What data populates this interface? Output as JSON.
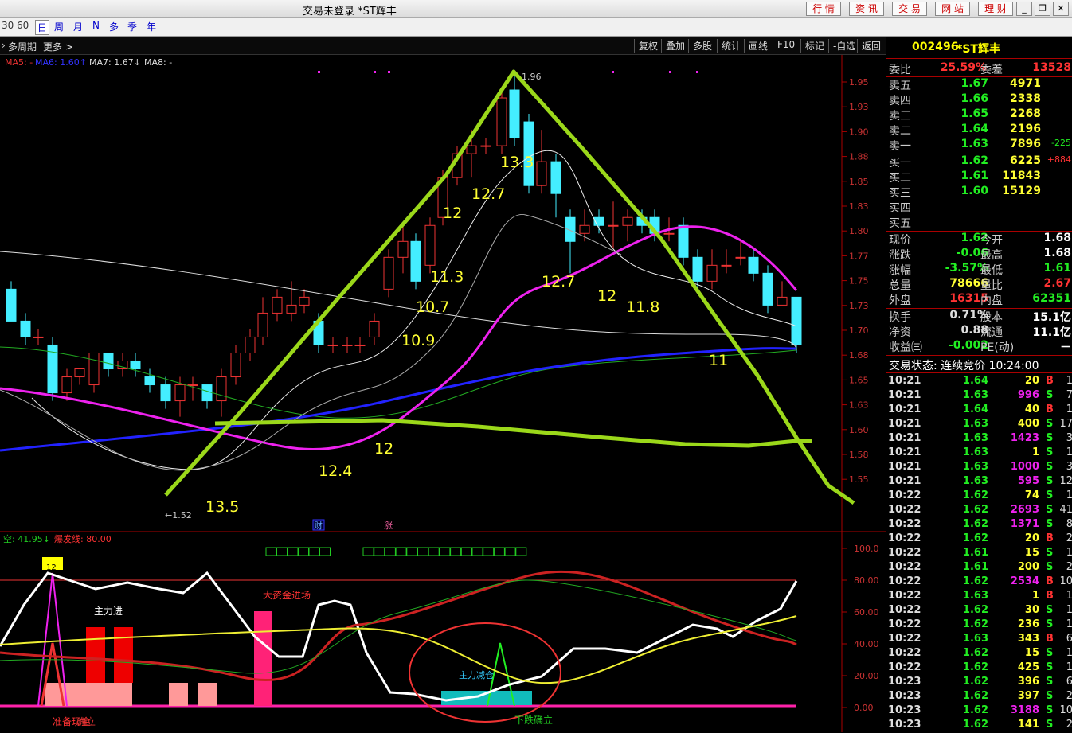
{
  "window": {
    "title": "交易未登录 *ST辉丰",
    "buttons": [
      "行 情",
      "资 讯",
      "交 易",
      "网 站",
      "理 财"
    ]
  },
  "toolbar": {
    "items": [
      "30",
      "60",
      "日",
      "周",
      "月",
      "N",
      "多",
      "季",
      "年"
    ]
  },
  "chartbar": {
    "left": [
      "多周期",
      "更多 >"
    ],
    "right": [
      "复权",
      "叠加",
      "多股",
      "统计",
      "画线",
      "F10",
      "标记",
      "-自选",
      "返回"
    ]
  },
  "ma_legend": {
    "ma5": "MA5: -",
    "ma6": "MA6: 1.60↑",
    "ma7": "MA7: 1.67↓",
    "ma8": "MA8: -"
  },
  "price_axis": [
    "1.95",
    "1.93",
    "1.90",
    "1.88",
    "1.85",
    "1.83",
    "1.80",
    "1.77",
    "1.75",
    "1.73",
    "1.70",
    "1.68",
    "1.65",
    "1.63",
    "1.60",
    "1.58",
    "1.55"
  ],
  "markers": {
    "high": "1.96",
    "low": "←1.52",
    "cai": "财",
    "zhang": "涨"
  },
  "annotations": [
    "13.3",
    "12.7",
    "12",
    "11.3",
    "10.7",
    "10.9",
    "12.7",
    "12",
    "11.8",
    "11",
    "12.4",
    "12",
    "13.5"
  ],
  "indicator": {
    "legend_kong": "空: 41.95↓",
    "legend_line": "爆发线: 80.00",
    "axis": [
      "100.0",
      "80.00",
      "60.00",
      "40.00",
      "20.00",
      "0.00"
    ],
    "labels": {
      "zhulijin": "主力进",
      "dazijin": "大资金进场",
      "zhulijianc": "主力减仓",
      "zhunbei": "准备现金",
      "xiadie": "下跌确立",
      "quelabel": "确立",
      "num": "12"
    }
  },
  "quote": {
    "code": "002496",
    "name": "*ST辉丰",
    "weibi": {
      "label": "委比",
      "value": "25.59%",
      "label2": "委差",
      "value2": "13528"
    },
    "sells": [
      {
        "label": "卖五",
        "price": "1.67",
        "vol": "4971",
        "chg": ""
      },
      {
        "label": "卖四",
        "price": "1.66",
        "vol": "2338",
        "chg": ""
      },
      {
        "label": "卖三",
        "price": "1.65",
        "vol": "2268",
        "chg": ""
      },
      {
        "label": "卖二",
        "price": "1.64",
        "vol": "2196",
        "chg": ""
      },
      {
        "label": "卖一",
        "price": "1.63",
        "vol": "7896",
        "chg": "-225"
      }
    ],
    "buys": [
      {
        "label": "买一",
        "price": "1.62",
        "vol": "6225",
        "chg": "+884"
      },
      {
        "label": "买二",
        "price": "1.61",
        "vol": "11843",
        "chg": ""
      },
      {
        "label": "买三",
        "price": "1.60",
        "vol": "15129",
        "chg": ""
      },
      {
        "label": "买四",
        "price": "",
        "vol": "",
        "chg": ""
      },
      {
        "label": "买五",
        "price": "",
        "vol": "",
        "chg": ""
      }
    ],
    "stats": [
      {
        "l1": "现价",
        "v1": "1.62",
        "l2": "今开",
        "v2": "1.68"
      },
      {
        "l1": "涨跌",
        "v1": "-0.06",
        "l2": "最高",
        "v2": "1.68"
      },
      {
        "l1": "涨幅",
        "v1": "-3.57%",
        "l2": "最低",
        "v2": "1.61"
      },
      {
        "l1": "总量",
        "v1": "78666",
        "l2": "量比",
        "v2": "2.67"
      },
      {
        "l1": "外盘",
        "v1": "16315",
        "l2": "内盘",
        "v2": "62351"
      }
    ],
    "stats2": [
      {
        "l1": "换手",
        "v1": "0.71%",
        "l2": "股本",
        "v2": "15.1亿"
      },
      {
        "l1": "净资",
        "v1": "0.88",
        "l2": "流通",
        "v2": "11.1亿"
      },
      {
        "l1": "收益㈢",
        "v1": "-0.002",
        "l2": "PE(动)",
        "v2": "－"
      }
    ],
    "status": "交易状态: 连续竞价 10:24:00",
    "trades": [
      [
        "10:21",
        "1.64",
        "20",
        "B",
        "1"
      ],
      [
        "10:21",
        "1.63",
        "996",
        "S",
        "7"
      ],
      [
        "10:21",
        "1.64",
        "40",
        "B",
        "1"
      ],
      [
        "10:21",
        "1.63",
        "400",
        "S",
        "17"
      ],
      [
        "10:21",
        "1.63",
        "1423",
        "S",
        "3"
      ],
      [
        "10:21",
        "1.63",
        "1",
        "S",
        "1"
      ],
      [
        "10:21",
        "1.63",
        "1000",
        "S",
        "3"
      ],
      [
        "10:21",
        "1.63",
        "595",
        "S",
        "12"
      ],
      [
        "10:22",
        "1.62",
        "74",
        "S",
        "1"
      ],
      [
        "10:22",
        "1.62",
        "2693",
        "S",
        "41"
      ],
      [
        "10:22",
        "1.62",
        "1371",
        "S",
        "8"
      ],
      [
        "10:22",
        "1.62",
        "20",
        "B",
        "2"
      ],
      [
        "10:22",
        "1.61",
        "15",
        "S",
        "1"
      ],
      [
        "10:22",
        "1.61",
        "200",
        "S",
        "2"
      ],
      [
        "10:22",
        "1.62",
        "2534",
        "B",
        "10"
      ],
      [
        "10:22",
        "1.63",
        "1",
        "B",
        "1"
      ],
      [
        "10:22",
        "1.62",
        "30",
        "S",
        "1"
      ],
      [
        "10:22",
        "1.62",
        "236",
        "S",
        "1"
      ],
      [
        "10:22",
        "1.63",
        "343",
        "B",
        "6"
      ],
      [
        "10:22",
        "1.62",
        "15",
        "S",
        "1"
      ],
      [
        "10:22",
        "1.62",
        "425",
        "S",
        "1"
      ],
      [
        "10:23",
        "1.62",
        "396",
        "S",
        "6"
      ],
      [
        "10:23",
        "1.62",
        "397",
        "S",
        "2"
      ],
      [
        "10:23",
        "1.62",
        "3188",
        "S",
        "10"
      ],
      [
        "10:23",
        "1.62",
        "141",
        "S",
        "2"
      ]
    ]
  }
}
